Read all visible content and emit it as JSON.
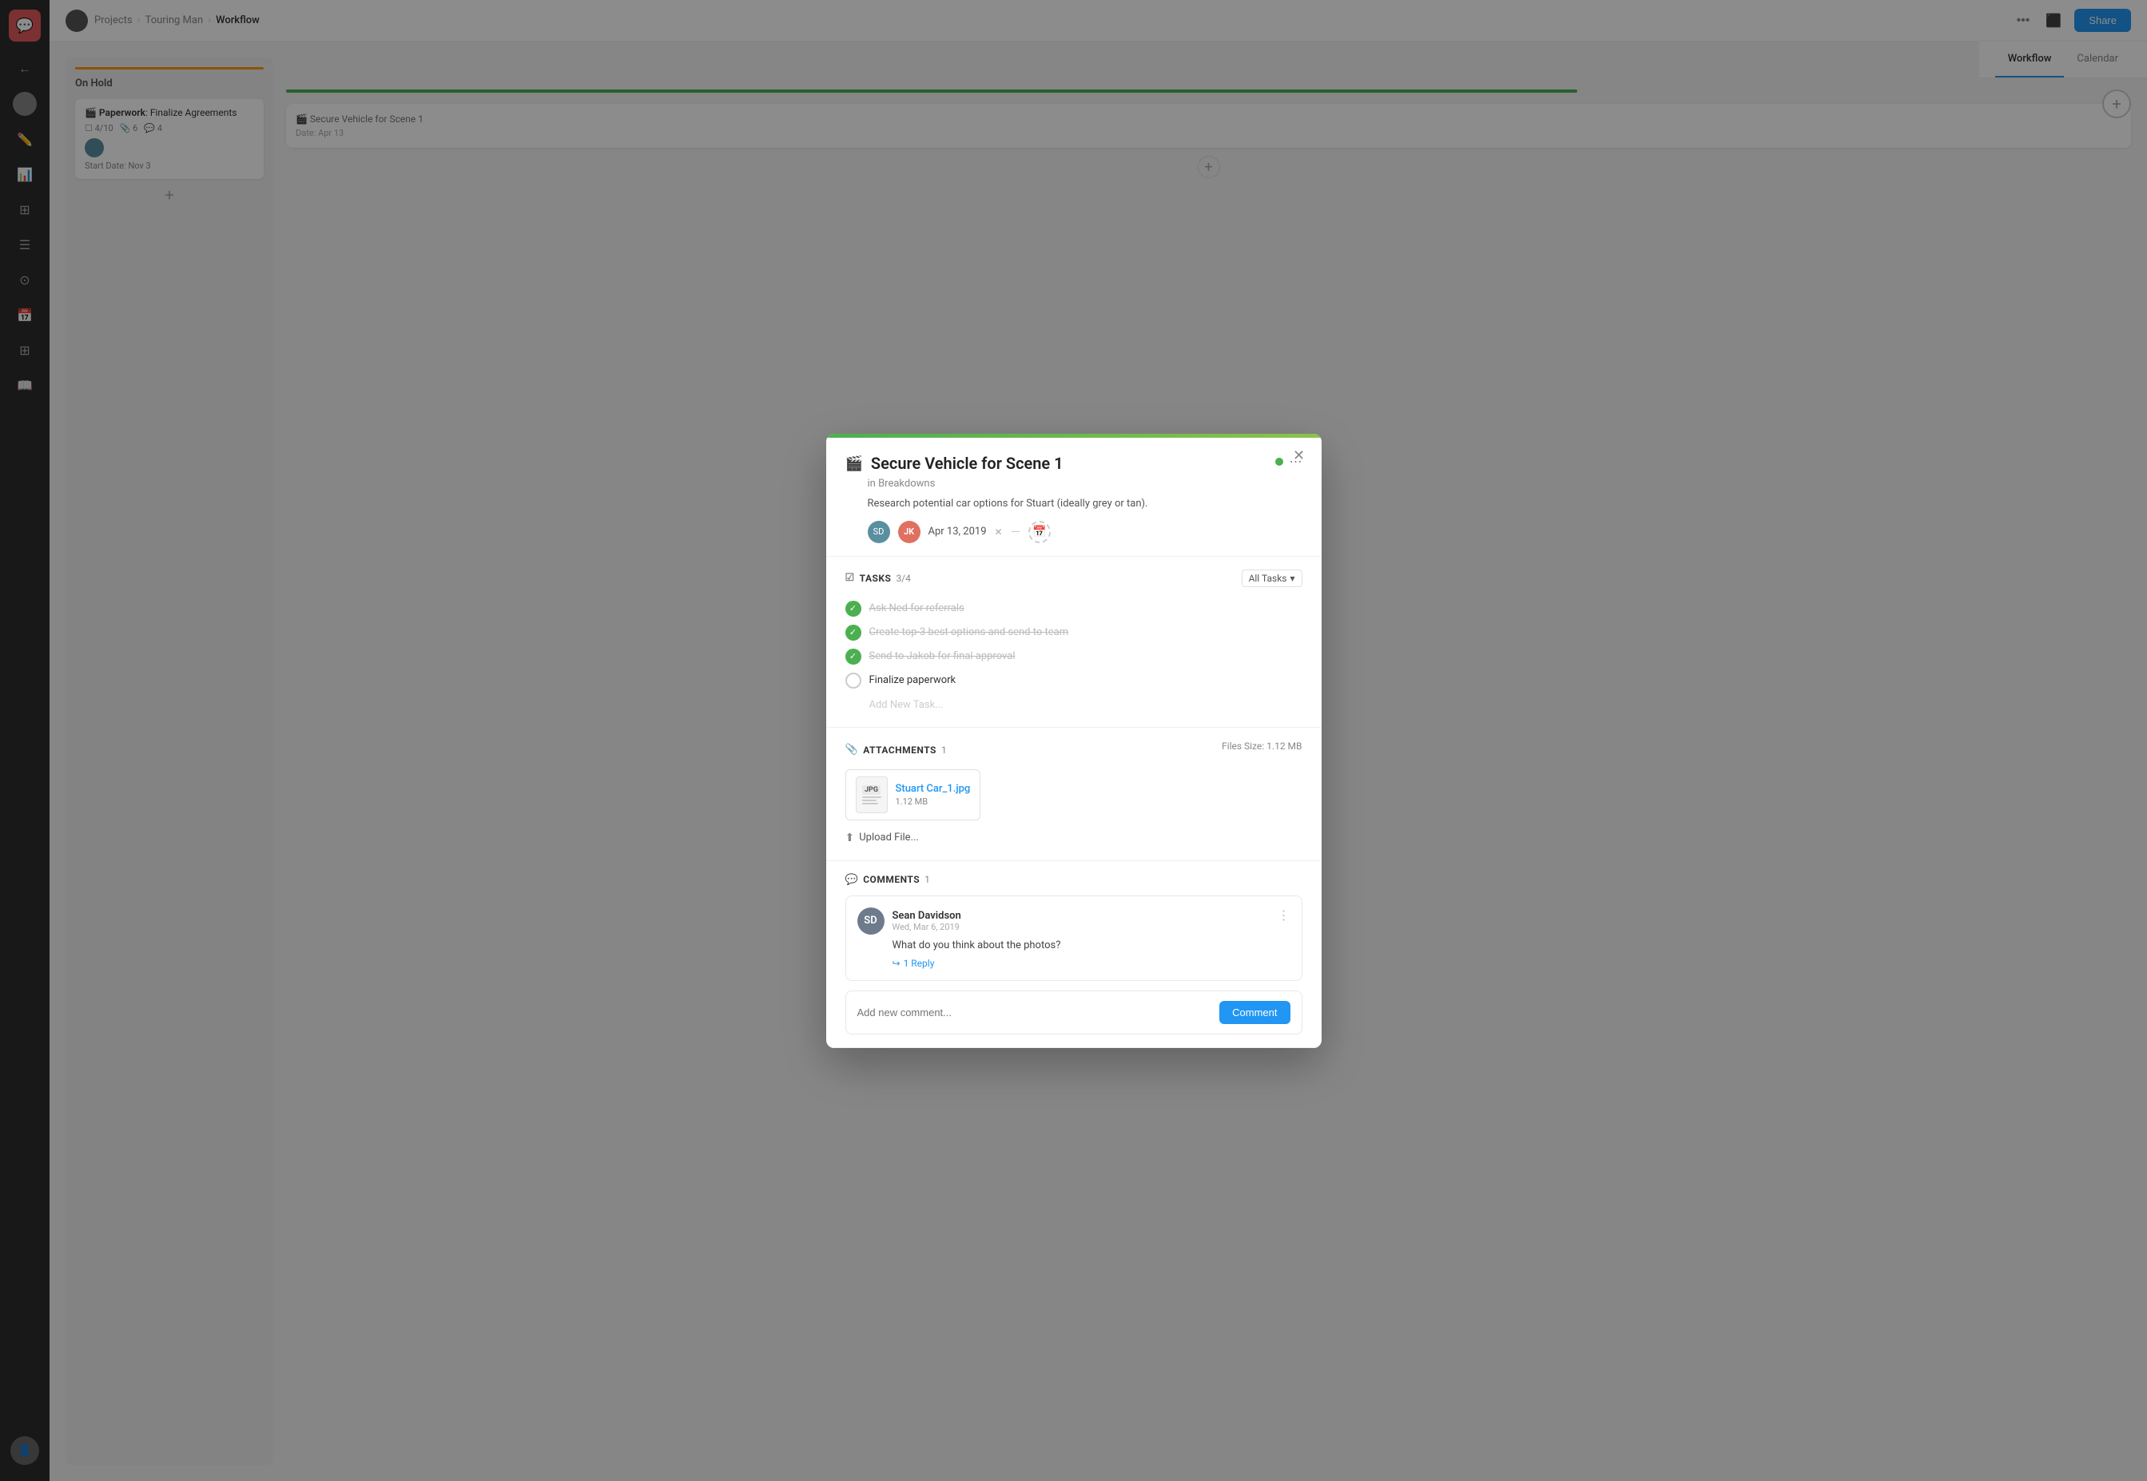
{
  "app": {
    "logo_icon": "💬",
    "sidebar_icons": [
      "←",
      "👤",
      "✏️",
      "📊",
      "⬛",
      "≡",
      "🌐",
      "📅",
      "≡",
      "⬛"
    ]
  },
  "breadcrumb": {
    "projects": "Projects",
    "project": "Touring Man",
    "current": "Workflow"
  },
  "topbar": {
    "more_icon": "•••",
    "layout_icon": "⬛",
    "share_label": "Share"
  },
  "tabs": {
    "workflow": "Workflow",
    "calendar": "Calendar"
  },
  "kanban": {
    "col1_title": "On Hold",
    "card1_title_prefix": "Paperwork",
    "card1_title_suffix": ": Finalize Agreements",
    "card1_tasks": "4/10",
    "card1_attachments": "6",
    "card1_comments": "4",
    "card1_date": "Start Date: Nov 3"
  },
  "modal": {
    "top_bar_color": "#4caf50",
    "title": "Secure Vehicle for Scene 1",
    "title_icon": "🎬",
    "status_color": "#4caf50",
    "subtitle": "in Breakdowns",
    "description": "Research potential car options for Stuart (ideally grey or tan).",
    "date_start": "Apr 13, 2019",
    "tasks_label": "TASKS",
    "tasks_count": "3/4",
    "tasks_filter": "All Tasks",
    "tasks": [
      {
        "id": 1,
        "label": "Ask Ned for referrals",
        "done": true
      },
      {
        "id": 2,
        "label": "Create top-3 best options and send to team",
        "done": true
      },
      {
        "id": 3,
        "label": "Send to Jakob for final approval",
        "done": true
      },
      {
        "id": 4,
        "label": "Finalize paperwork",
        "done": false
      }
    ],
    "add_task_placeholder": "Add New Task...",
    "attachments_label": "ATTACHMENTS",
    "attachments_count": "1",
    "files_size_label": "Files Size: 1.12 MB",
    "attachment": {
      "file_type": "JPG",
      "file_name": "Stuart Car_1.jpg",
      "file_size": "1.12 MB"
    },
    "upload_label": "Upload File...",
    "comments_label": "COMMENTS",
    "comments_count": "1",
    "comment": {
      "user": "Sean Davidson",
      "date": "Wed, Mar 6, 2019",
      "text": "What do you think about the photos?",
      "reply_label": "1 Reply"
    },
    "new_comment_placeholder": "Add new comment...",
    "comment_btn": "Comment"
  }
}
